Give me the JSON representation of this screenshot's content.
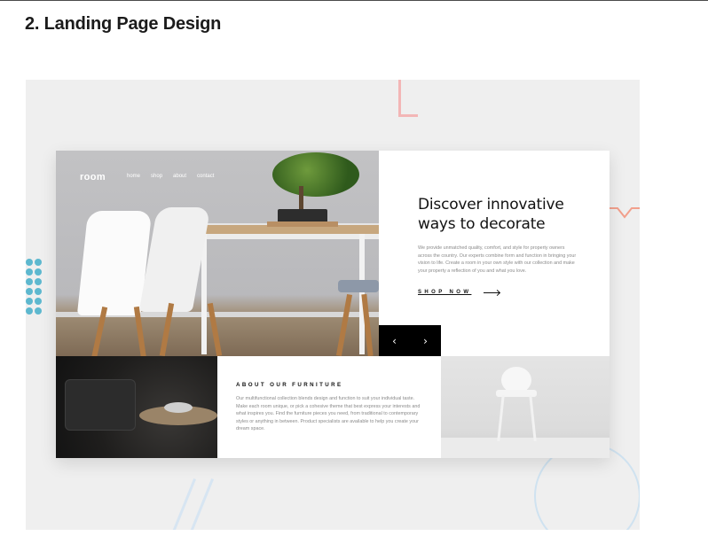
{
  "section": {
    "heading": "2. Landing Page Design"
  },
  "mockup": {
    "logo": "room",
    "nav": [
      "home",
      "shop",
      "about",
      "contact"
    ],
    "hero": {
      "headline_line1": "Discover innovative",
      "headline_line2": "ways to decorate",
      "body": "We provide unmatched quality, comfort, and style for property owners across the country. Our experts combine form and function in bringing your vision to life. Create a room in your own style with our collection and make your property a reflection of you and what you love.",
      "cta": "SHOP NOW"
    },
    "slider": {
      "prev_glyph": "‹",
      "next_glyph": "›"
    },
    "about": {
      "title": "ABOUT OUR FURNITURE",
      "body": "Our multifunctional collection blends design and function to suit your individual taste. Make each room unique, or pick a cohesive theme that best express your interests and what inspires you. Find the furniture pieces you need, from traditional to contemporary styles or anything in between. Product specialists are available to help you create your dream space."
    }
  },
  "colors": {
    "stage_bg": "#efefef",
    "deco_pink": "#f3b6b6",
    "deco_salmon": "#f2a08c",
    "deco_teal": "#5db8cf"
  },
  "icons": [
    "prev-arrow-icon",
    "next-arrow-icon",
    "arrow-right-icon"
  ]
}
